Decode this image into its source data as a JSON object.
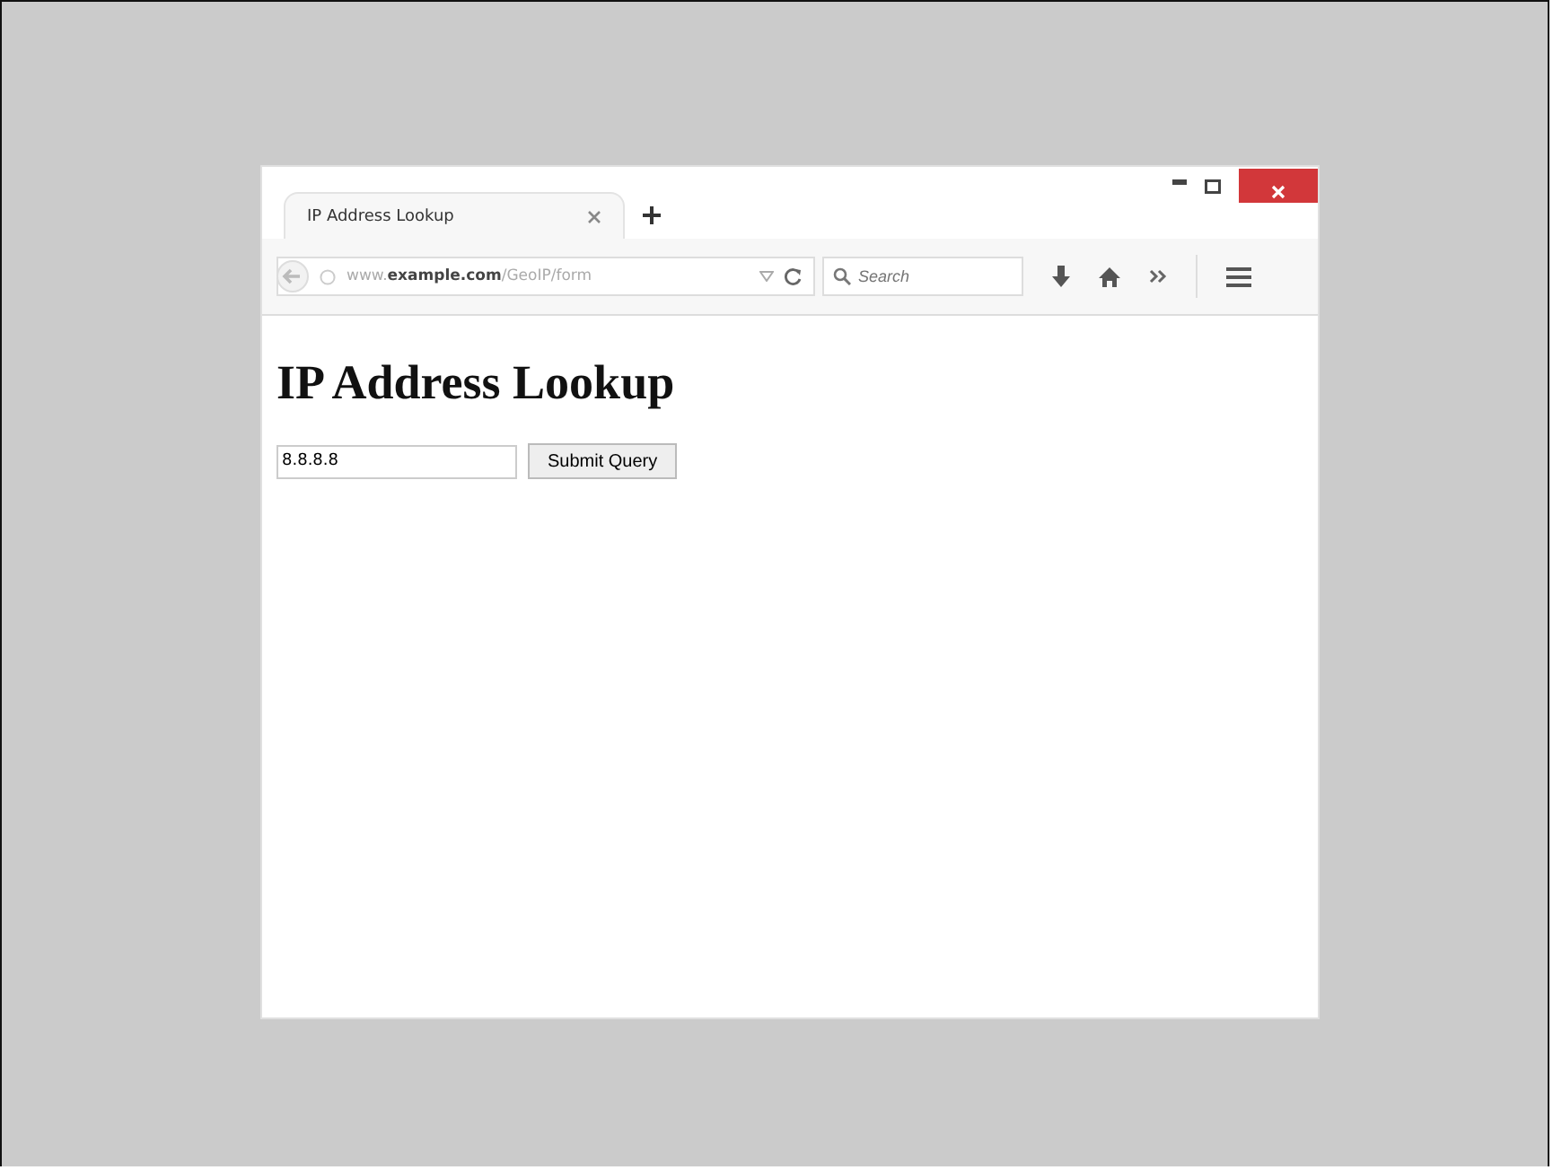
{
  "tabs": [
    {
      "title": "IP Address Lookup"
    }
  ],
  "address_bar": {
    "url": "www.**example.com**/GeoIP/form"
  },
  "search": {
    "placeholder": "Search"
  },
  "page": {
    "heading": "IP Address Lookup",
    "ip_field": {
      "value": "8.8.8.8"
    },
    "submit_button": "Submit Query"
  }
}
